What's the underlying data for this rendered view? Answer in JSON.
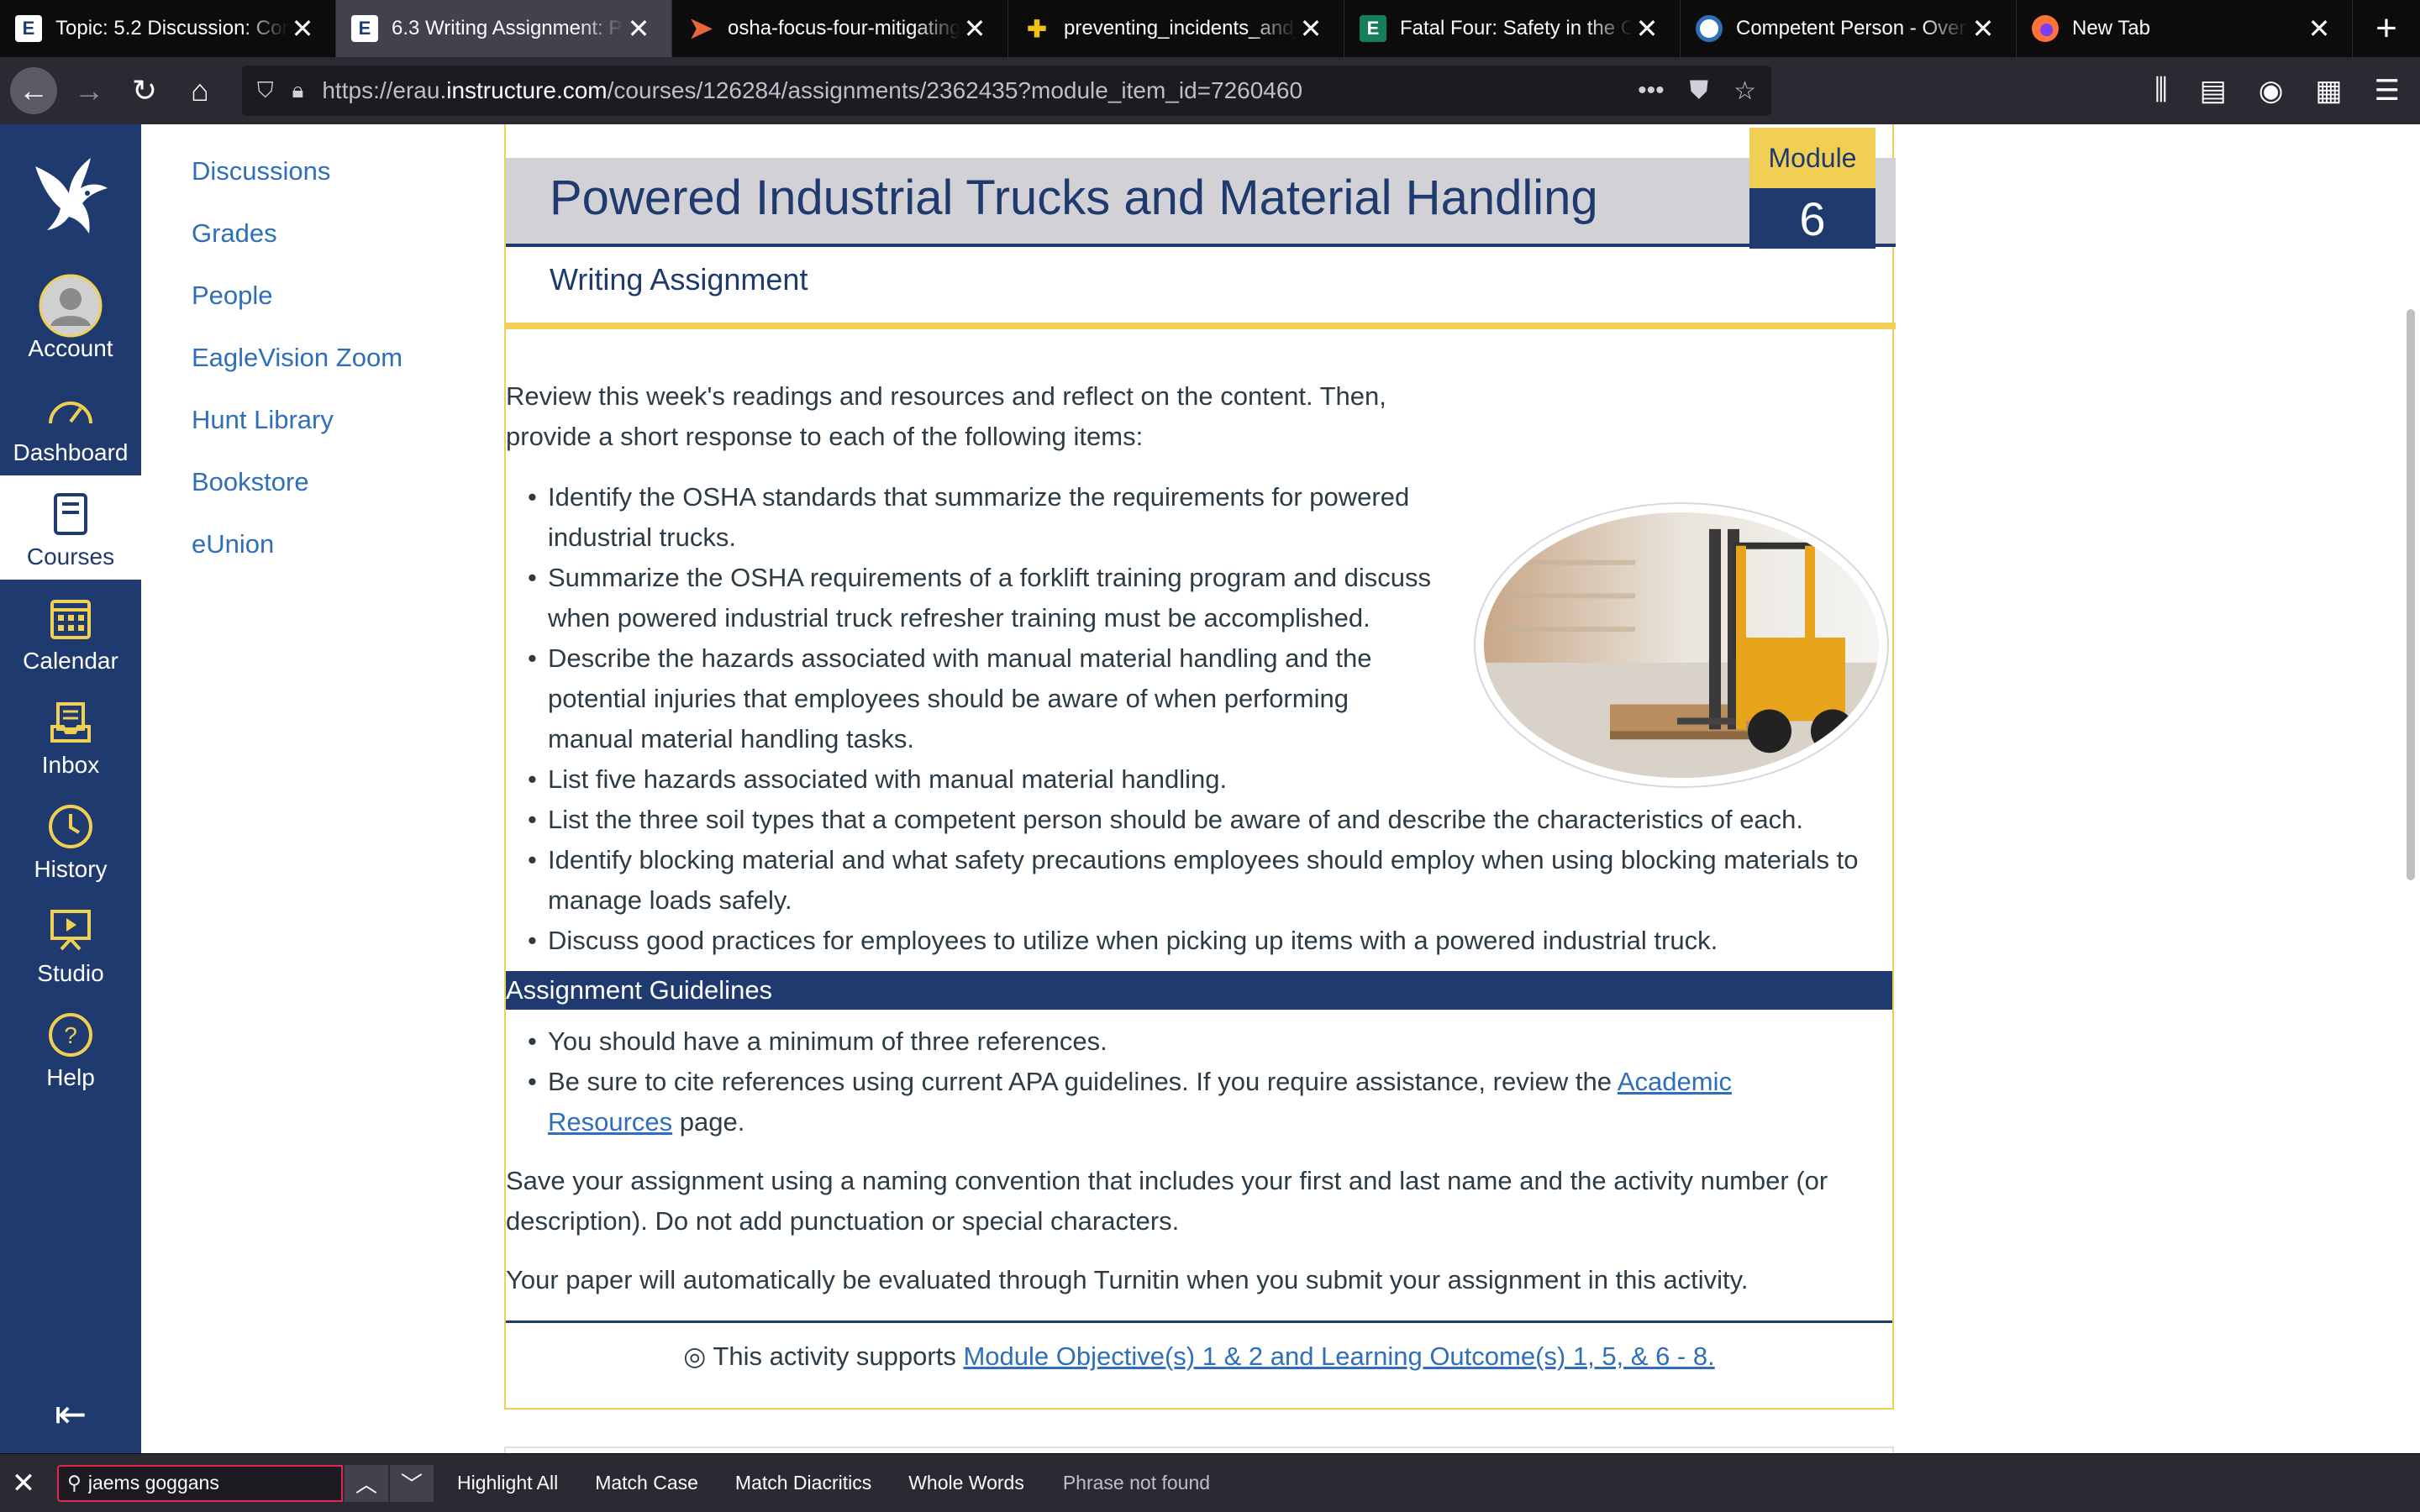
{
  "browser": {
    "tabs": [
      {
        "title": "Topic: 5.2 Discussion: Con",
        "favicon": "erau-icon",
        "active": false
      },
      {
        "title": "6.3 Writing Assignment: Po",
        "favicon": "erau-icon",
        "active": true
      },
      {
        "title": "osha-focus-four-mitigating",
        "favicon": "play-icon",
        "active": false
      },
      {
        "title": "preventing_incidents_and_",
        "favicon": "shield-icon",
        "active": false
      },
      {
        "title": "Fatal Four: Safety in the Co",
        "favicon": "e-icon",
        "active": false
      },
      {
        "title": "Competent Person - Overv",
        "favicon": "globe-icon",
        "active": false
      },
      {
        "title": "New Tab",
        "favicon": "firefox-icon",
        "active": false
      }
    ],
    "url_prefix": "https://erau.",
    "url_domain": "instructure.com",
    "url_path": "/courses/126284/assignments/2362435?module_item_id=7260460"
  },
  "global_nav": [
    {
      "label": "Account",
      "icon": "account-icon"
    },
    {
      "label": "Dashboard",
      "icon": "dashboard-icon"
    },
    {
      "label": "Courses",
      "icon": "courses-icon",
      "active": true
    },
    {
      "label": "Calendar",
      "icon": "calendar-icon"
    },
    {
      "label": "Inbox",
      "icon": "inbox-icon"
    },
    {
      "label": "History",
      "icon": "history-icon"
    },
    {
      "label": "Studio",
      "icon": "studio-icon"
    },
    {
      "label": "Help",
      "icon": "help-icon"
    }
  ],
  "course_nav": [
    "Discussions",
    "Grades",
    "People",
    "EagleVision Zoom",
    "Hunt Library",
    "Bookstore",
    "eUnion"
  ],
  "page": {
    "title": "Powered Industrial Trucks and Material Handling",
    "module_label": "Module",
    "module_number": "6",
    "subtitle": "Writing Assignment",
    "intro": "Review this week's readings and resources and reflect on the content. Then, provide a short response to each of the following items:",
    "items": [
      "Identify the OSHA standards that summarize the requirements for powered industrial trucks.",
      "Summarize the OSHA requirements of a forklift training program and discuss when powered industrial truck refresher training must be accomplished.",
      "Describe the hazards associated with manual material handling and the potential injuries that employees should be aware of when performing manual material handling tasks.",
      "List five hazards associated with manual material handling.",
      "List the three soil types that a competent person should be aware of and describe the characteristics of each.",
      "Identify blocking material and what safety precautions employees should employ when using blocking materials to manage loads safely.",
      "Discuss good practices for employees to utilize when picking up items with a powered industrial truck."
    ],
    "guidelines_heading": "Assignment Guidelines",
    "guideline_1": "You should have a minimum of three references.",
    "guideline_2_pre": "Be sure to cite references using current APA guidelines. If you require assistance, review the ",
    "guideline_2_link": "Academic Resources",
    "guideline_2_post": " page.",
    "save_note": "Save your assignment using a naming convention that includes your first and last name and the activity number (or description). Do not add punctuation or special characters.",
    "turnitin_note": "Your paper will automatically be evaluated through Turnitin when you submit your assignment in this activity.",
    "objective_pre": "This activity supports ",
    "objective_link": "Module Objective(s) 1 & 2 and Learning Outcome(s) 1, 5, & 6 - 8."
  },
  "find_bar": {
    "query": "jaems goggans",
    "options": [
      "Highlight All",
      "Match Case",
      "Match Diacritics",
      "Whole Words"
    ],
    "status": "Phrase not found"
  },
  "colors": {
    "navy": "#1f3a6e",
    "gold": "#f1cf55",
    "link": "#2f6fba"
  }
}
